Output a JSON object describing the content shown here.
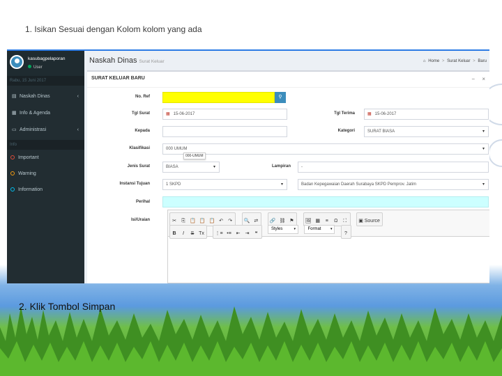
{
  "slide": {
    "step1": "1. Isikan Sesuai dengan Kolom kolom yang ada",
    "step2": "2. Klik Tombol Simpan"
  },
  "user": {
    "name": "kasubagpelaporan",
    "status": "User"
  },
  "sidebar": {
    "date": "Rabu, 15 Juni 2017",
    "items": [
      {
        "label": "Naskah Dinas",
        "icon": "document-icon",
        "chevron": "‹"
      },
      {
        "label": "Info & Agenda",
        "icon": "calendar-icon",
        "chevron": ""
      },
      {
        "label": "Administrasi",
        "icon": "monitor-icon",
        "chevron": "‹"
      }
    ],
    "section": "Info",
    "labels": [
      {
        "label": "Important",
        "color": "#dd4b39"
      },
      {
        "label": "Warning",
        "color": "#f39c12"
      },
      {
        "label": "Information",
        "color": "#00c0ef"
      }
    ]
  },
  "header": {
    "title": "Naskah Dinas",
    "subtitle": "Surat Keluar",
    "breadcrumb": [
      "Home",
      ">",
      "Surat Keluar",
      ">",
      "Baru"
    ]
  },
  "box": {
    "title": "SURAT KELUAR BARU",
    "tools": [
      "−",
      "×"
    ]
  },
  "form": {
    "no_ref": {
      "label": "No. Ref",
      "value": ""
    },
    "tgl_surat": {
      "label": "Tgl Surat",
      "value": "15-06-2017"
    },
    "tgl_terima": {
      "label": "Tgl Terima",
      "value": "15-06-2017"
    },
    "kepada": {
      "label": "Kepada",
      "value": ""
    },
    "kategori": {
      "label": "Kategori",
      "value": "SURAT BIASA"
    },
    "klasifikasi": {
      "label": "Klasifikasi",
      "value": "000 UMUM",
      "tooltip": "000-UMUM"
    },
    "jenis_surat": {
      "label": "Jenis Surat",
      "value": "BIASA"
    },
    "lampiran": {
      "label": "Lampiran",
      "value": "-"
    },
    "instansi_tujuan": {
      "label": "Instansi Tujuan",
      "value": "1 SKPD"
    },
    "instansi_nama": {
      "value": "Badan Kepegawaian Daerah Surabaya SKPD Pemprov. Jatim"
    },
    "perihal": {
      "label": "Perihal",
      "value": ""
    },
    "isi_uraian": {
      "label": "Isi/Uraian"
    }
  },
  "editor": {
    "source_label": "Source",
    "styles_label": "Styles",
    "format_label": "Format",
    "row1": [
      "✂",
      "⎘",
      "📋",
      "📋",
      "📋",
      "↶",
      "↷"
    ],
    "row1b": [
      "🔍",
      "⇄"
    ],
    "row1c": [
      "🔗",
      "⛓",
      "⚑"
    ],
    "row1d": [
      "🖼",
      "▦",
      "≡",
      "Ω",
      "⛶"
    ],
    "row2": [
      "B",
      "I",
      "S",
      "Tx"
    ],
    "row2b": [
      "⋮≡",
      "•≡",
      "⇤",
      "⇥",
      "❝"
    ],
    "help": "?"
  },
  "colors": {
    "accent": "#3c8dbc",
    "sidebar": "#222d32",
    "highlight_yellow": "#ffff00",
    "highlight_cyan": "#ccffff"
  }
}
